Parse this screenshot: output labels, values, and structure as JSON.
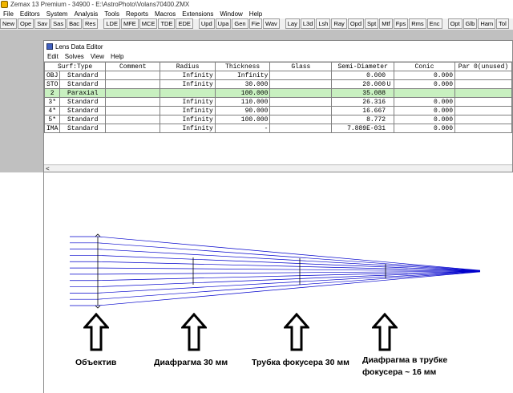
{
  "app": {
    "title": "Zemax 13 Premium - 34900 - E:\\AstroPhoto\\Volans70400.ZMX"
  },
  "menu": [
    "File",
    "Editors",
    "System",
    "Analysis",
    "Tools",
    "Reports",
    "Macros",
    "Extensions",
    "Window",
    "Help"
  ],
  "toolbar_groups": [
    [
      "New",
      "Ope",
      "Sav",
      "Sas",
      "Bac",
      "Res"
    ],
    [
      "LDE",
      "MFE",
      "MCE",
      "TDE",
      "EDE"
    ],
    [
      "Upd",
      "Upa",
      "Gen",
      "Fie",
      "Wav"
    ],
    [
      "Lay",
      "L3d",
      "Lsh",
      "Ray",
      "Opd",
      "Spt",
      "Mtf",
      "Fps",
      "Rms",
      "Enc"
    ],
    [
      "Opt",
      "Glb",
      "Ham",
      "Tol"
    ]
  ],
  "lde": {
    "title": "Lens Data Editor",
    "menu": [
      "Edit",
      "Solves",
      "View",
      "Help"
    ],
    "columns": [
      "Surf:Type",
      "Comment",
      "Radius",
      "Thickness",
      "Glass",
      "Semi-Diameter",
      "Conic",
      "Par 0(unused)"
    ],
    "rows": [
      {
        "surf": "OBJ",
        "type": "Standard",
        "comment": "",
        "radius": "Infinity",
        "thickness": "Infinity",
        "glass": "",
        "semi": "0.000",
        "flag": "",
        "conic": "0.000",
        "par0": ""
      },
      {
        "surf": "STO",
        "type": "Standard",
        "comment": "",
        "radius": "Infinity",
        "thickness": "30.000",
        "glass": "",
        "semi": "20.000",
        "flag": "U",
        "conic": "0.000",
        "par0": ""
      },
      {
        "surf": "2",
        "type": "Paraxial",
        "comment": "",
        "radius": "",
        "thickness": "100.000",
        "glass": "",
        "semi": "35.088",
        "flag": "",
        "conic": "",
        "par0": ""
      },
      {
        "surf": "3*",
        "type": "Standard",
        "comment": "",
        "radius": "Infinity",
        "thickness": "110.000",
        "glass": "",
        "semi": "26.316",
        "flag": "",
        "conic": "0.000",
        "par0": ""
      },
      {
        "surf": "4*",
        "type": "Standard",
        "comment": "",
        "radius": "Infinity",
        "thickness": "90.000",
        "glass": "",
        "semi": "16.667",
        "flag": "",
        "conic": "0.000",
        "par0": ""
      },
      {
        "surf": "5*",
        "type": "Standard",
        "comment": "",
        "radius": "Infinity",
        "thickness": "100.000",
        "glass": "",
        "semi": "8.772",
        "flag": "",
        "conic": "0.000",
        "par0": ""
      },
      {
        "surf": "IMA",
        "type": "Standard",
        "comment": "",
        "radius": "Infinity",
        "thickness": "-",
        "glass": "",
        "semi": "7.889E-031",
        "flag": "",
        "conic": "0.000",
        "par0": ""
      }
    ],
    "highlight_row": 2,
    "scroll_left": "<"
  },
  "annotations": {
    "objective": "Объектив",
    "diaphragm30": "Диафрагма 30 мм",
    "focuser_tube": "Трубка фокусера 30 мм",
    "diaphragm_tube_line1": "Диафрагма в трубке",
    "diaphragm_tube_line2": "фокусера ~ 16 мм"
  },
  "colors": {
    "ray": "#0000cc",
    "highlight": "#c8f0c0",
    "workspace": "#c0c0c0"
  }
}
